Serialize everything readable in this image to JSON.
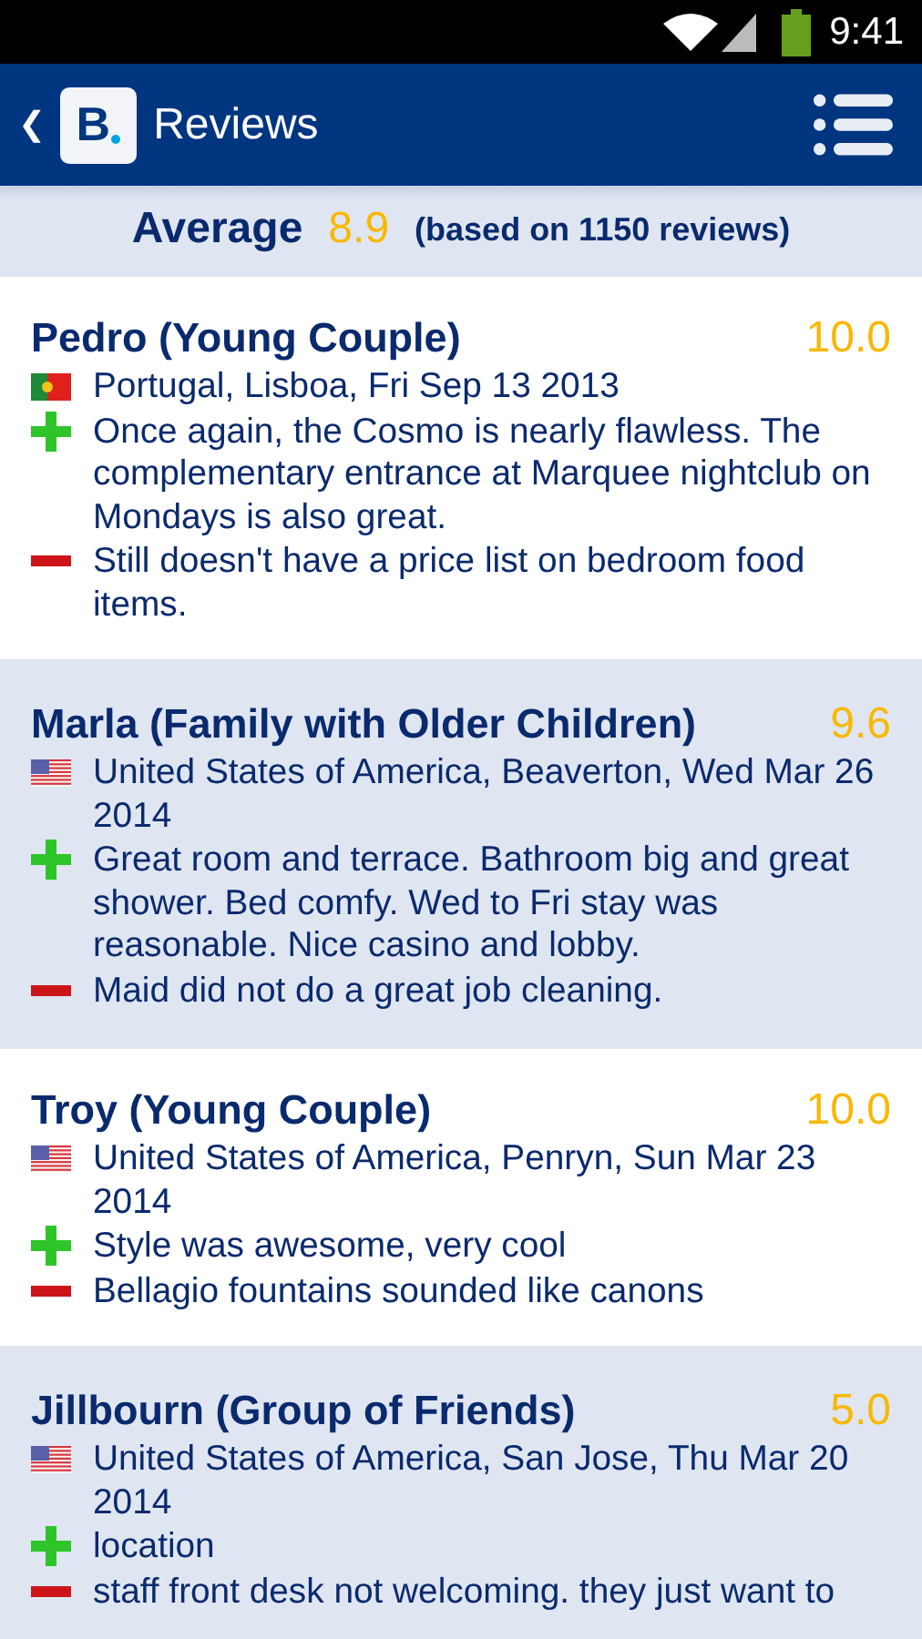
{
  "status_bar": {
    "time": "9:41"
  },
  "app_bar": {
    "back": "❮",
    "logo": "B",
    "title": "Reviews"
  },
  "summary": {
    "label": "Average",
    "score": "8.9",
    "count": "(based on 1150 reviews)"
  },
  "reviews": [
    {
      "name": "Pedro (Young Couple)",
      "score": "10.0",
      "flag": {
        "kind": "pt"
      },
      "meta": "Portugal, Lisboa, Fri Sep 13 2013",
      "pros": "Once again, the Cosmo is nearly flawless. The complementary entrance at Marquee nightclub on Mondays is also great.",
      "cons": "Still doesn't have a price list on bedroom food items."
    },
    {
      "name": "Marla (Family with Older Children)",
      "score": "9.6",
      "flag": {
        "kind": "us"
      },
      "meta": "United States of America, Beaverton, Wed Mar 26 2014",
      "pros": "Great room and terrace. Bathroom big and great shower. Bed comfy. Wed to Fri stay was reasonable. Nice casino and lobby.",
      "cons": "Maid did not do a great job cleaning."
    },
    {
      "name": "Troy (Young Couple)",
      "score": "10.0",
      "flag": {
        "kind": "us"
      },
      "meta": "United States of America, Penryn, Sun Mar 23 2014",
      "pros": "Style was awesome, very cool",
      "cons": "Bellagio fountains sounded like canons"
    },
    {
      "name": "Jillbourn (Group of Friends)",
      "score": "5.0",
      "flag": {
        "kind": "us"
      },
      "meta": "United States of America, San Jose, Thu Mar 20 2014",
      "pros": "location",
      "cons": "staff front desk not welcoming. they just want to"
    }
  ]
}
